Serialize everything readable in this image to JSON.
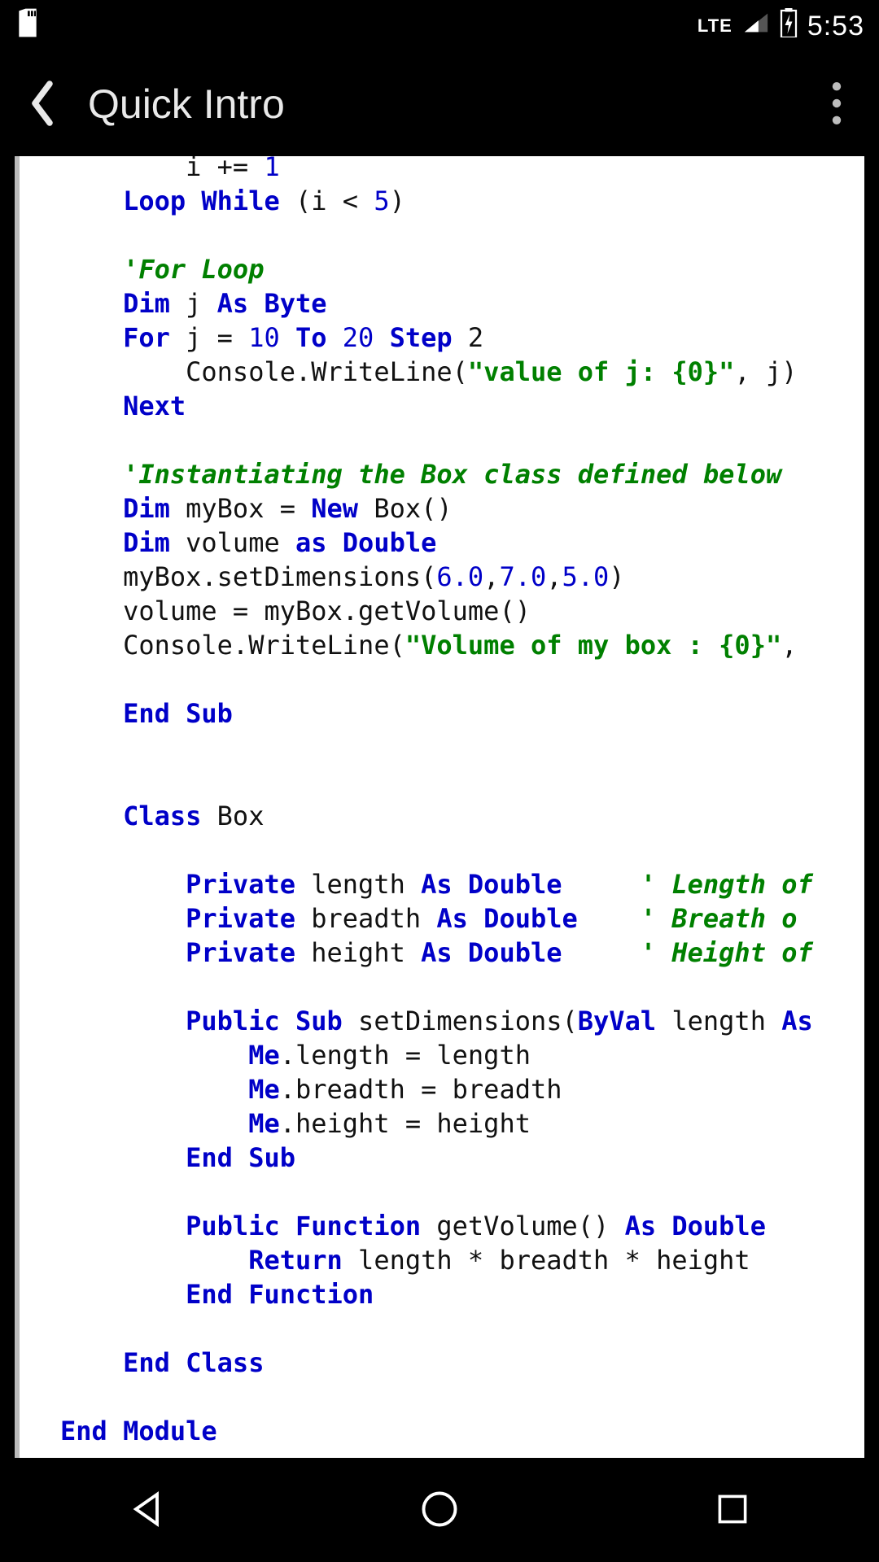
{
  "status": {
    "network": "LTE",
    "time": "5:53",
    "icons": [
      "sd-card-icon",
      "lte-icon",
      "signal-icon",
      "battery-charging-icon"
    ]
  },
  "appbar": {
    "title": "Quick Intro"
  },
  "code": {
    "tokens": [
      {
        "t": "        i += ",
        "c": ""
      },
      {
        "t": "1",
        "c": "num"
      },
      {
        "t": "\n",
        "c": ""
      },
      {
        "t": "    ",
        "c": ""
      },
      {
        "t": "Loop While",
        "c": "kw"
      },
      {
        "t": " (i < ",
        "c": ""
      },
      {
        "t": "5",
        "c": "num"
      },
      {
        "t": ")\n",
        "c": ""
      },
      {
        "t": "\n",
        "c": ""
      },
      {
        "t": "    'For Loop",
        "c": "cm"
      },
      {
        "t": "\n",
        "c": ""
      },
      {
        "t": "    ",
        "c": ""
      },
      {
        "t": "Dim",
        "c": "kw"
      },
      {
        "t": " j ",
        "c": ""
      },
      {
        "t": "As Byte",
        "c": "kw"
      },
      {
        "t": "\n",
        "c": ""
      },
      {
        "t": "    ",
        "c": ""
      },
      {
        "t": "For",
        "c": "kw"
      },
      {
        "t": " j = ",
        "c": ""
      },
      {
        "t": "10",
        "c": "num"
      },
      {
        "t": " ",
        "c": ""
      },
      {
        "t": "To",
        "c": "kw"
      },
      {
        "t": " ",
        "c": ""
      },
      {
        "t": "20",
        "c": "num"
      },
      {
        "t": " ",
        "c": ""
      },
      {
        "t": "Step",
        "c": "kw"
      },
      {
        "t": " 2\n",
        "c": ""
      },
      {
        "t": "        Console.WriteLine(",
        "c": ""
      },
      {
        "t": "\"value of j: {0}\"",
        "c": "str"
      },
      {
        "t": ", j)\n",
        "c": ""
      },
      {
        "t": "    ",
        "c": ""
      },
      {
        "t": "Next",
        "c": "kw"
      },
      {
        "t": "\n",
        "c": ""
      },
      {
        "t": "\n",
        "c": ""
      },
      {
        "t": "    'Instantiating the Box class defined below",
        "c": "cm"
      },
      {
        "t": "\n",
        "c": ""
      },
      {
        "t": "    ",
        "c": ""
      },
      {
        "t": "Dim",
        "c": "kw"
      },
      {
        "t": " myBox = ",
        "c": ""
      },
      {
        "t": "New",
        "c": "kw"
      },
      {
        "t": " Box()\n",
        "c": ""
      },
      {
        "t": "    ",
        "c": ""
      },
      {
        "t": "Dim",
        "c": "kw"
      },
      {
        "t": " volume ",
        "c": ""
      },
      {
        "t": "as Double",
        "c": "kw"
      },
      {
        "t": "\n",
        "c": ""
      },
      {
        "t": "    myBox.setDimensions(",
        "c": ""
      },
      {
        "t": "6.0",
        "c": "num"
      },
      {
        "t": ",",
        "c": ""
      },
      {
        "t": "7.0",
        "c": "num"
      },
      {
        "t": ",",
        "c": ""
      },
      {
        "t": "5.0",
        "c": "num"
      },
      {
        "t": ")\n",
        "c": ""
      },
      {
        "t": "    volume = myBox.getVolume()\n",
        "c": ""
      },
      {
        "t": "    Console.WriteLine(",
        "c": ""
      },
      {
        "t": "\"Volume of my box : {0}\"",
        "c": "str"
      },
      {
        "t": ", \n",
        "c": ""
      },
      {
        "t": "\n",
        "c": ""
      },
      {
        "t": "    ",
        "c": ""
      },
      {
        "t": "End Sub",
        "c": "kw"
      },
      {
        "t": "\n",
        "c": ""
      },
      {
        "t": "\n",
        "c": ""
      },
      {
        "t": "\n",
        "c": ""
      },
      {
        "t": "    ",
        "c": ""
      },
      {
        "t": "Class",
        "c": "kw"
      },
      {
        "t": " Box\n",
        "c": ""
      },
      {
        "t": "\n",
        "c": ""
      },
      {
        "t": "        ",
        "c": ""
      },
      {
        "t": "Private",
        "c": "kw"
      },
      {
        "t": " length ",
        "c": ""
      },
      {
        "t": "As Double",
        "c": "kw"
      },
      {
        "t": "     ",
        "c": ""
      },
      {
        "t": "' Length of",
        "c": "cm"
      },
      {
        "t": "\n",
        "c": ""
      },
      {
        "t": "        ",
        "c": ""
      },
      {
        "t": "Private",
        "c": "kw"
      },
      {
        "t": " breadth ",
        "c": ""
      },
      {
        "t": "As Double",
        "c": "kw"
      },
      {
        "t": "    ",
        "c": ""
      },
      {
        "t": "' Breath o",
        "c": "cm"
      },
      {
        "t": "\n",
        "c": ""
      },
      {
        "t": "        ",
        "c": ""
      },
      {
        "t": "Private",
        "c": "kw"
      },
      {
        "t": " height ",
        "c": ""
      },
      {
        "t": "As Double",
        "c": "kw"
      },
      {
        "t": "     ",
        "c": ""
      },
      {
        "t": "' Height of",
        "c": "cm"
      },
      {
        "t": "\n",
        "c": ""
      },
      {
        "t": "\n",
        "c": ""
      },
      {
        "t": "        ",
        "c": ""
      },
      {
        "t": "Public Sub",
        "c": "kw"
      },
      {
        "t": " setDimensions(",
        "c": ""
      },
      {
        "t": "ByVal",
        "c": "kw"
      },
      {
        "t": " length ",
        "c": ""
      },
      {
        "t": "As",
        "c": "kw"
      },
      {
        "t": "\n",
        "c": ""
      },
      {
        "t": "            ",
        "c": ""
      },
      {
        "t": "Me",
        "c": "kw"
      },
      {
        "t": ".length = length\n",
        "c": ""
      },
      {
        "t": "            ",
        "c": ""
      },
      {
        "t": "Me",
        "c": "kw"
      },
      {
        "t": ".breadth = breadth\n",
        "c": ""
      },
      {
        "t": "            ",
        "c": ""
      },
      {
        "t": "Me",
        "c": "kw"
      },
      {
        "t": ".height = height\n",
        "c": ""
      },
      {
        "t": "        ",
        "c": ""
      },
      {
        "t": "End Sub",
        "c": "kw"
      },
      {
        "t": "\n",
        "c": ""
      },
      {
        "t": "\n",
        "c": ""
      },
      {
        "t": "        ",
        "c": ""
      },
      {
        "t": "Public Function",
        "c": "kw"
      },
      {
        "t": " getVolume() ",
        "c": ""
      },
      {
        "t": "As Double",
        "c": "kw"
      },
      {
        "t": "\n",
        "c": ""
      },
      {
        "t": "            ",
        "c": ""
      },
      {
        "t": "Return",
        "c": "kw"
      },
      {
        "t": " length * breadth * height\n",
        "c": ""
      },
      {
        "t": "        ",
        "c": ""
      },
      {
        "t": "End Function",
        "c": "kw"
      },
      {
        "t": "\n",
        "c": ""
      },
      {
        "t": "\n",
        "c": ""
      },
      {
        "t": "    ",
        "c": ""
      },
      {
        "t": "End Class",
        "c": "kw"
      },
      {
        "t": "\n",
        "c": ""
      },
      {
        "t": "\n",
        "c": ""
      },
      {
        "t": "End Module",
        "c": "kw"
      },
      {
        "t": "\n",
        "c": ""
      }
    ]
  }
}
